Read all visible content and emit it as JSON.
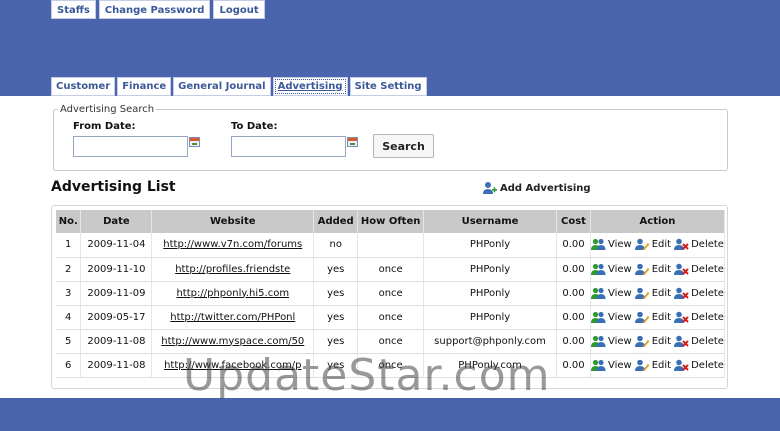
{
  "topnav": [
    "Staffs",
    "Change Password",
    "Logout"
  ],
  "tabs": [
    {
      "label": "Customer",
      "active": false
    },
    {
      "label": "Finance",
      "active": false
    },
    {
      "label": "General Journal",
      "active": false
    },
    {
      "label": "Advertising",
      "active": true
    },
    {
      "label": "Site Setting",
      "active": false
    }
  ],
  "search": {
    "legend": "Advertising Search",
    "from_label": "From Date:",
    "to_label": "To Date:",
    "from_value": "",
    "to_value": "",
    "button": "Search"
  },
  "list": {
    "title": "Advertising List",
    "add_label": "Add Advertising"
  },
  "table": {
    "headers": [
      "No.",
      "Date",
      "Website",
      "Added",
      "How Often",
      "Username",
      "Cost",
      "Action"
    ],
    "actions": [
      "View",
      "Edit",
      "Delete"
    ],
    "rows": [
      {
        "no": "1",
        "date": "2009-11-04",
        "website": "http://www.v7n.com/forums",
        "added": "no",
        "how_often": "",
        "username": "PHPonly",
        "cost": "0.00"
      },
      {
        "no": "2",
        "date": "2009-11-10",
        "website": "http://profiles.friendste",
        "added": "yes",
        "how_often": "once",
        "username": "PHPonly",
        "cost": "0.00"
      },
      {
        "no": "3",
        "date": "2009-11-09",
        "website": "http://phponly.hi5.com",
        "added": "yes",
        "how_often": "once",
        "username": "PHPonly",
        "cost": "0.00"
      },
      {
        "no": "4",
        "date": "2009-05-17",
        "website": "http://twitter.com/PHPonl",
        "added": "yes",
        "how_often": "once",
        "username": "PHPonly",
        "cost": "0.00"
      },
      {
        "no": "5",
        "date": "2009-11-08",
        "website": "http://www.myspace.com/50",
        "added": "yes",
        "how_often": "once",
        "username": "support@phponly.com",
        "cost": "0.00"
      },
      {
        "no": "6",
        "date": "2009-11-08",
        "website": "http://www.facebook.com/p",
        "added": "yes",
        "how_often": "once",
        "username": "PHPonly.com",
        "cost": "0.00"
      }
    ]
  },
  "watermark": "UpdateStar.com",
  "colors": {
    "header": "#4a64ad",
    "link": "#3b5998",
    "table_header": "#c9c9c9"
  },
  "icons": [
    "calendar-icon",
    "add-user-icon",
    "view-user-icon",
    "edit-user-icon",
    "delete-user-icon"
  ]
}
